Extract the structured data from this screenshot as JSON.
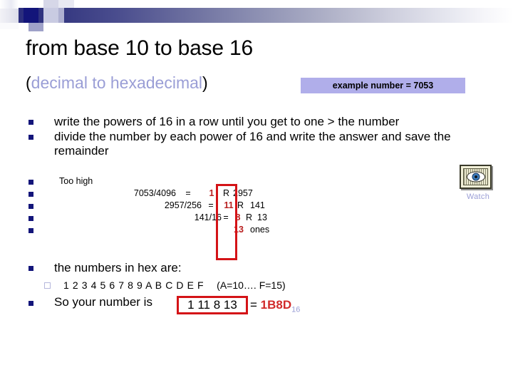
{
  "slide": {
    "title": "from base 10 to base 16",
    "subtitle_open": "(",
    "subtitle_inner": "decimal to  hexadecimal",
    "subtitle_close": ")",
    "example_badge": "example number = 7053"
  },
  "instructions": [
    "write the powers of 16 in a row until you get to one > the number",
    "divide the number by each power of 16 and write the answer and save the remainder"
  ],
  "math": {
    "too_high_label": "Too high",
    "rows": [
      {
        "lead": "7053/4096",
        "eq": "=",
        "quotient": "1",
        "r": "R",
        "remainder": "2957"
      },
      {
        "lead": "2957/256",
        "eq": "=",
        "quotient": "11",
        "r": "R",
        "remainder": "141"
      },
      {
        "lead": "141/16",
        "eq": "=",
        "quotient": "8",
        "r": "R",
        "remainder": "13"
      },
      {
        "lead": "",
        "eq": "",
        "quotient": "13",
        "r": "ones",
        "remainder": ""
      }
    ]
  },
  "hex": {
    "intro": "the numbers in hex are:",
    "digits": "1 2 3 4 5 6 7 8 9 A B C D E F",
    "note": "(A=10…. F=15)",
    "conclusion_label": "So your number is",
    "boxed_digits": "1 11 8 13",
    "equals": "=",
    "hex_value": "1B8D",
    "hex_subscript": "16"
  },
  "watch": {
    "label": "Watch",
    "icon": "eye-watch-icon"
  },
  "colors": {
    "bar_start": "#2b2e7e",
    "bullet_navy": "#13157a",
    "accent_red": "#d41317",
    "hex_red": "#d12b2b",
    "lavender": "#9a9ed6",
    "badge_bg": "#b0aeea"
  }
}
